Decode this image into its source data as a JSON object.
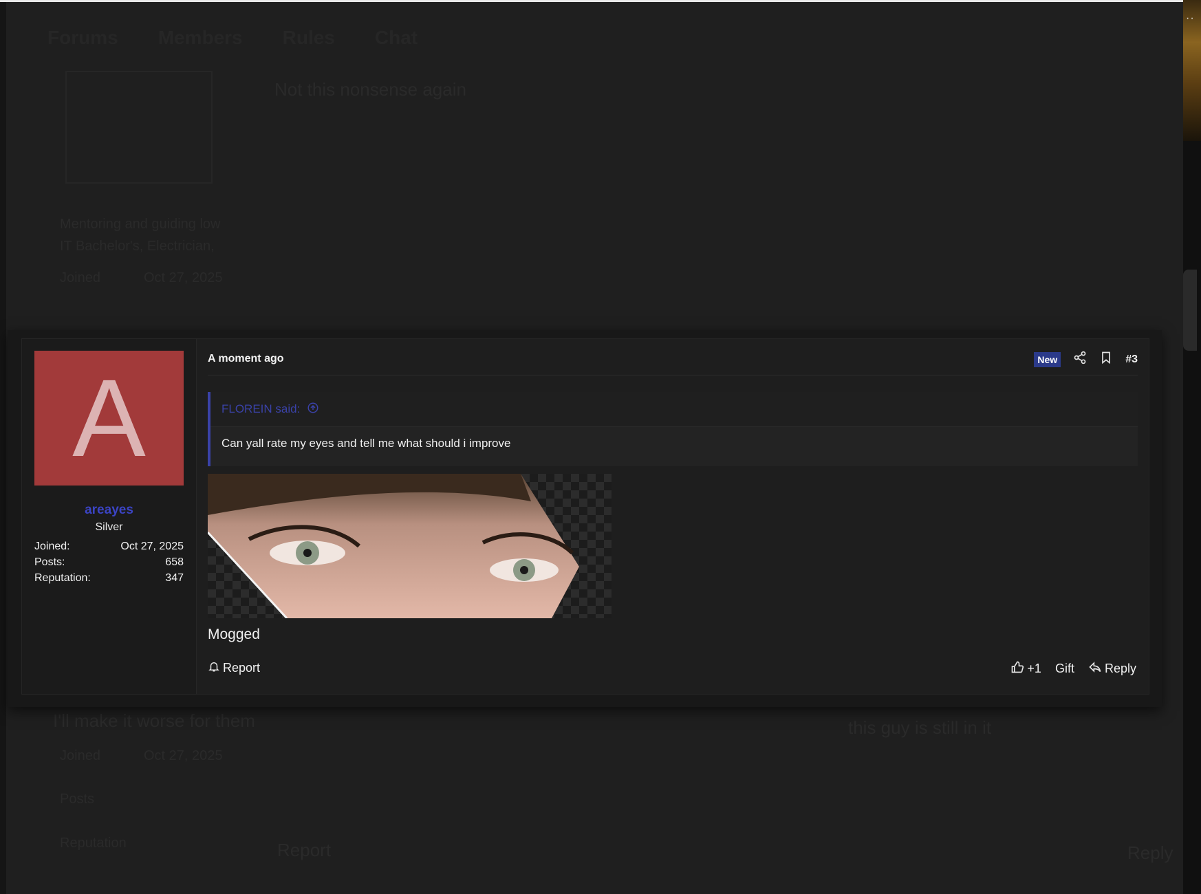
{
  "background": {
    "nav": [
      "Forums",
      "Members",
      "Rules",
      "Chat"
    ],
    "lines": [
      "Not this nonsense again",
      "Mentoring and guiding low",
      "IT Bachelor's, Electrician, ",
      "Joined",
      "Oct 27, 2025",
      "I'll make it worse for them",
      "this guy is still in it",
      "Report",
      "Reply",
      "Posts",
      "Reputation"
    ]
  },
  "post": {
    "author": {
      "avatar_letter": "A",
      "avatar_color": "#a23a3a",
      "username": "areayes",
      "rank": "Silver",
      "stats": [
        {
          "label": "Joined:",
          "value": "Oct 27, 2025"
        },
        {
          "label": "Posts:",
          "value": "658"
        },
        {
          "label": "Reputation:",
          "value": "347"
        }
      ]
    },
    "time": "A moment ago",
    "new_badge": "New",
    "post_number": "#3",
    "quote": {
      "author": "FLOREIN said:",
      "text": "Can yall rate my eyes and tell me what should i improve"
    },
    "body": "Mogged",
    "actions": {
      "report": "Report",
      "like": "+1",
      "gift": "Gift",
      "reply": "Reply"
    }
  },
  "colors": {
    "accent": "#3a42a8",
    "username": "#3b44c4",
    "new_badge": "#2b3a8a"
  },
  "icons": [
    "share-icon",
    "bookmark-icon",
    "arrow-up-circle-icon",
    "bell-icon",
    "thumbs-up-icon",
    "reply-arrow-icon"
  ]
}
